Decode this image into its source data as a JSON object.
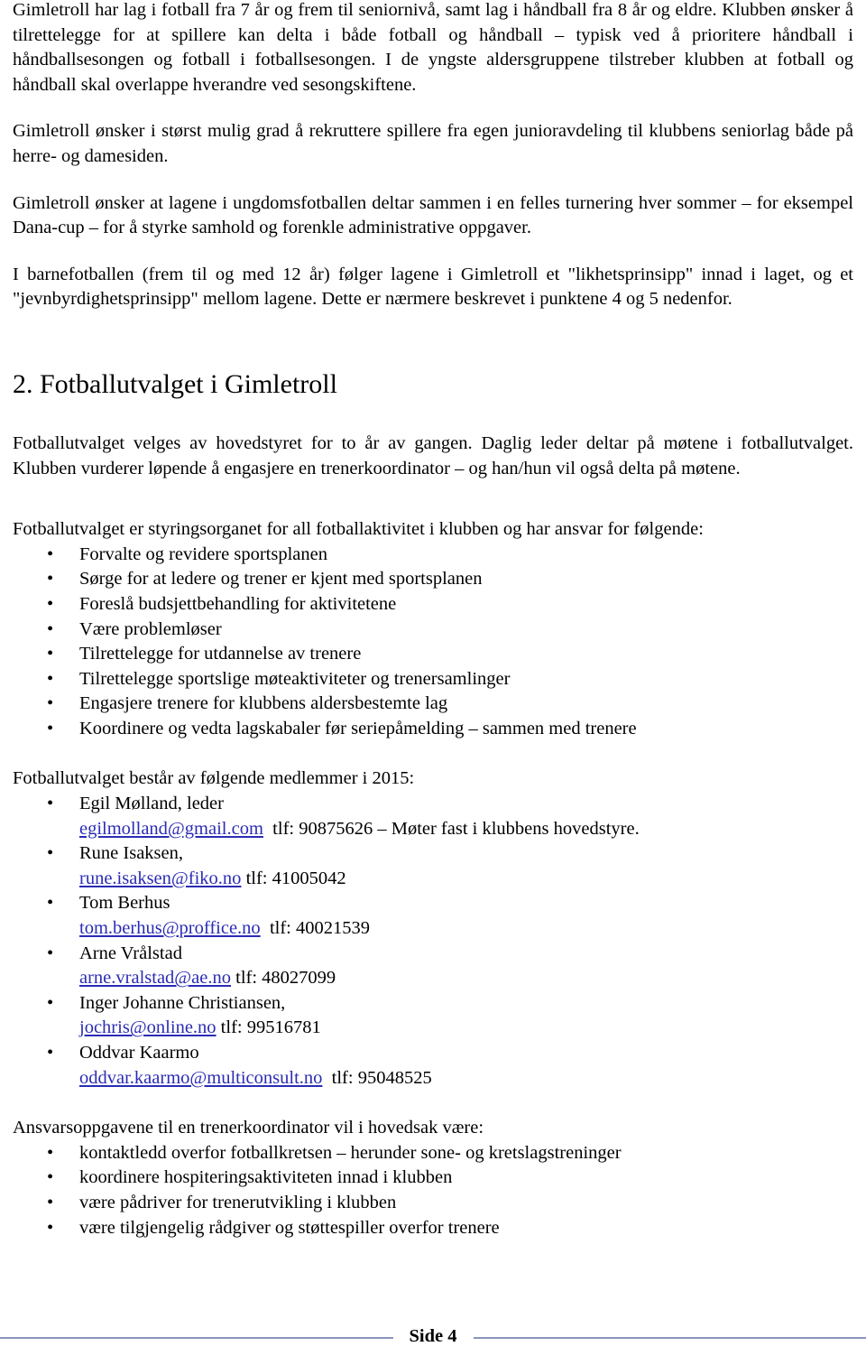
{
  "document": {
    "page_label": "Side 4",
    "link_color": "#2b2bb5",
    "rule_color": "#8a95bd"
  },
  "body": {
    "paragraphs": [
      {
        "id": "p1",
        "text": "Gimletroll har lag i fotball fra 7 år og frem til seniornivå, samt lag i håndball fra 8 år og eldre. Klubben ønsker å tilrettelegge for at spillere kan delta i både fotball og håndball – typisk ved å prioritere håndball i håndballsesongen og fotball i fotballsesongen. I de yngste aldersgruppene tilstreber klubben at fotball og håndball skal overlappe hverandre ved sesongskiftene."
      },
      {
        "id": "p2",
        "text": "Gimletroll ønsker i størst mulig grad å rekruttere spillere fra egen junioravdeling til klubbens seniorlag både på herre- og damesiden."
      },
      {
        "id": "p3",
        "text": "Gimletroll ønsker at lagene i ungdomsfotballen deltar sammen i en felles turnering hver sommer – for eksempel Dana-cup – for å styrke samhold og forenkle administrative oppgaver."
      },
      {
        "id": "p4",
        "text": "I barnefotballen (frem til og med 12 år) følger lagene i Gimletroll et \"likhetsprinsipp\" innad i laget, og et \"jevnbyrdighetsprinsipp\" mellom lagene. Dette er nærmere beskrevet i punktene 4 og 5 nedenfor."
      }
    ]
  },
  "section2": {
    "heading": "2. Fotballutvalget i Gimletroll",
    "intro_paragraph": "Fotballutvalget velges av hovedstyret for to år av gangen. Daglig leder deltar på møtene i fotballutvalget. Klubben vurderer løpende å engasjere en trenerkoordinator – og han/hun vil også delta på møtene.",
    "responsibilities_lead": "Fotballutvalget er styringsorganet for all fotballaktivitet i klubben og har ansvar for følgende:",
    "responsibilities": [
      "Forvalte og revidere sportsplanen",
      "Sørge for at ledere og trener er kjent med sportsplanen",
      "Foreslå budsjettbehandling for aktivitetene",
      "Være problemløser",
      "Tilrettelegge for utdannelse av trenere",
      "Tilrettelegge sportslige møteaktiviteter og trenersamlinger",
      "Engasjere trenere for klubbens aldersbestemte lag",
      "Koordinere og vedta lagskabaler før seriepåmelding – sammen med trenere"
    ],
    "members_lead": "Fotballutvalget består av følgende medlemmer i 2015:",
    "members": [
      {
        "name": "Egil Mølland, leder",
        "email": "egilmolland@gmail.com",
        "contact": "tlf: 90875626 – Møter fast i klubbens hovedstyre."
      },
      {
        "name": "Rune Isaksen,",
        "email": "rune.isaksen@fiko.no",
        "contact": "tlf: 41005042"
      },
      {
        "name": "Tom Berhus",
        "email": "tom.berhus@proffice.no",
        "contact": "tlf: 40021539"
      },
      {
        "name": "Arne Vrålstad",
        "email": "arne.vralstad@ae.no",
        "contact": "tlf: 48027099"
      },
      {
        "name": "Inger Johanne Christiansen,",
        "email": "jochris@online.no",
        "contact": "tlf: 99516781"
      },
      {
        "name": "Oddvar Kaarmo",
        "email": "oddvar.kaarmo@multiconsult.no",
        "contact": "tlf: 95048525"
      }
    ],
    "coordinator_lead": "Ansvarsoppgavene til en trenerkoordinator vil i hovedsak være:",
    "coordinator_tasks": [
      "kontaktledd overfor fotballkretsen – herunder sone- og kretslagstreninger",
      "koordinere hospiteringsaktiviteten innad i klubben",
      "være pådriver for trenerutvikling i klubben",
      "være tilgjengelig rådgiver og støttespiller overfor trenere"
    ]
  },
  "icons": {
    "bullet": "•"
  }
}
